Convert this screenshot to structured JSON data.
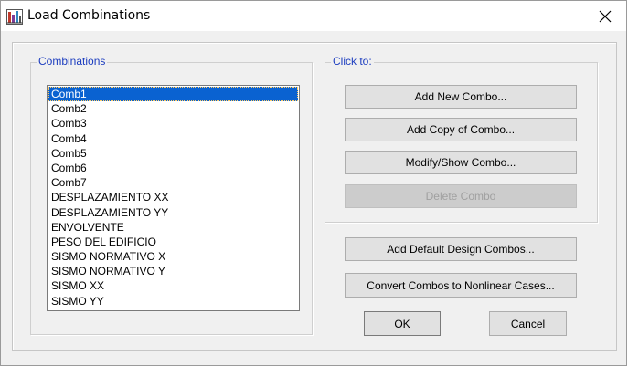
{
  "window": {
    "title": "Load Combinations",
    "close_glyph": "✕"
  },
  "combinations": {
    "legend": "Combinations",
    "selected_index": 0,
    "items": [
      "Comb1",
      "Comb2",
      "Comb3",
      "Comb4",
      "Comb5",
      "Comb6",
      "Comb7",
      "DESPLAZAMIENTO XX",
      "DESPLAZAMIENTO YY",
      "ENVOLVENTE",
      "PESO DEL EDIFICIO",
      "SISMO NORMATIVO X",
      "SISMO NORMATIVO Y",
      "SISMO XX",
      "SISMO YY"
    ]
  },
  "click_to": {
    "legend": "Click to:",
    "add_new": "Add New Combo...",
    "add_copy": "Add Copy of Combo...",
    "modify_show": "Modify/Show Combo...",
    "delete": "Delete Combo"
  },
  "actions": {
    "add_default": "Add Default Design Combos...",
    "convert": "Convert Combos to Nonlinear Cases...",
    "ok": "OK",
    "cancel": "Cancel"
  },
  "colors": {
    "selection": "#0a62d1",
    "legend_text": "#1c3dbf"
  },
  "icons": {
    "app": "load-combinations-app-icon",
    "close": "close-icon"
  }
}
